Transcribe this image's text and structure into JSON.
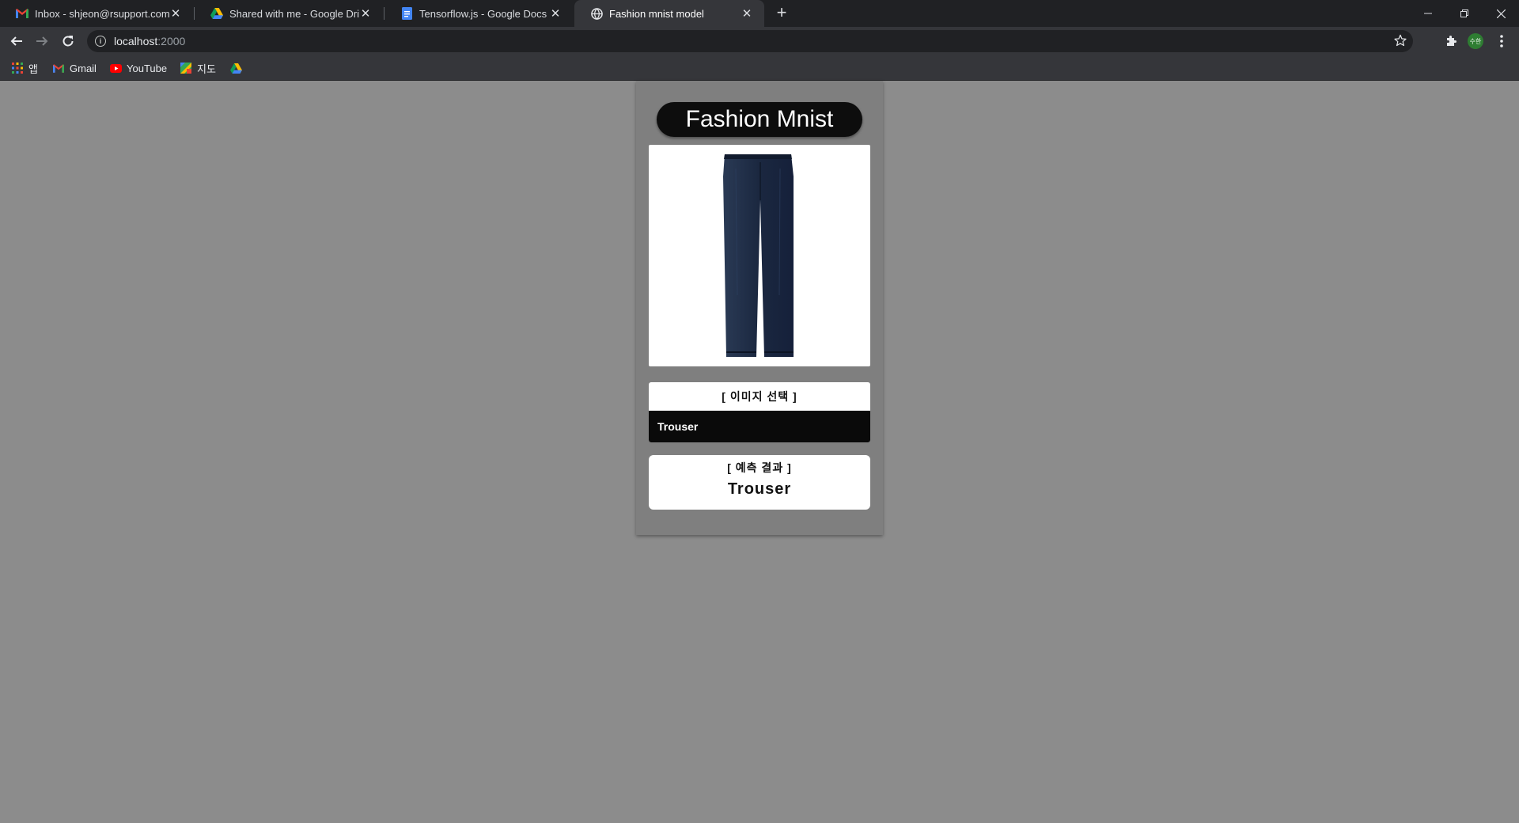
{
  "browser": {
    "tabs": [
      {
        "title": "Inbox - shjeon@rsupport.com -",
        "icon": "gmail-icon",
        "active": false
      },
      {
        "title": "Shared with me - Google Drive",
        "icon": "google-drive-icon",
        "active": false
      },
      {
        "title": "Tensorflow.js - Google Docs",
        "icon": "google-docs-icon",
        "active": false
      },
      {
        "title": "Fashion mnist model",
        "icon": "globe-icon",
        "active": true
      }
    ],
    "address": {
      "host": "localhost",
      "port": ":2000"
    },
    "bookmarks": [
      {
        "label": "앱",
        "icon": "apps-grid-icon"
      },
      {
        "label": "Gmail",
        "icon": "gmail-icon"
      },
      {
        "label": "YouTube",
        "icon": "youtube-icon"
      },
      {
        "label": "지도",
        "icon": "maps-icon"
      },
      {
        "label": "",
        "icon": "google-drive-icon"
      }
    ],
    "profile_initials": "수한",
    "colors": {
      "tabstrip": "#202124",
      "toolbar": "#35363a",
      "omnibox": "#202124"
    }
  },
  "page": {
    "title": "Fashion Mnist",
    "image": {
      "alt": "navy trousers",
      "icon": "trouser-image"
    },
    "select": {
      "label": "[ 이미지 선택 ]",
      "value": "Trouser"
    },
    "result": {
      "label": "[ 예측 결과 ]",
      "value": "Trouser"
    },
    "colors": {
      "background": "#8c8c8c",
      "card": "#7f7f7f",
      "pill": "#0d0d0d",
      "trouser": "#1f2d44"
    }
  }
}
